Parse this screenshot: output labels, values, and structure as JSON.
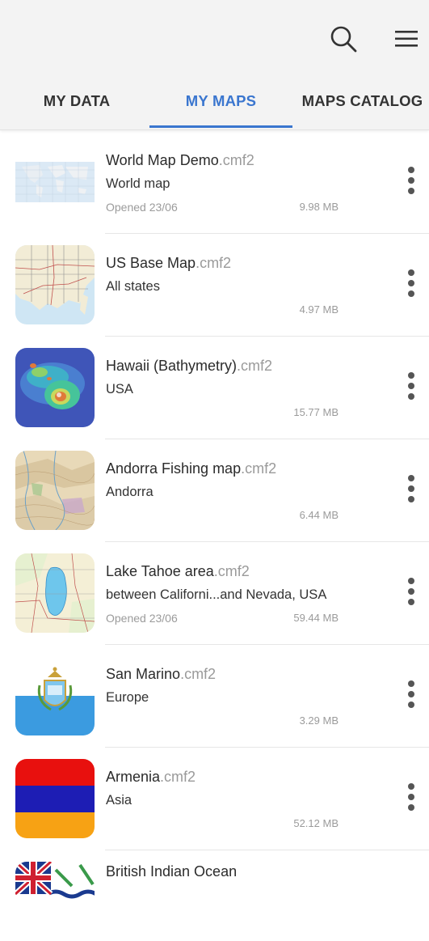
{
  "header": {
    "icons": {
      "search": "search-icon",
      "menu": "menu-icon"
    },
    "tabs": [
      {
        "label": "MY DATA"
      },
      {
        "label": "MY MAPS"
      },
      {
        "label": "MAPS CATALOG"
      }
    ],
    "active_tab": "MY MAPS",
    "accent_color": "#3a76cf"
  },
  "maps": [
    {
      "name": "World Map Demo",
      "ext": ".cmf2",
      "subtitle": "World map",
      "opened": "Opened 23/06",
      "size": "9.98 MB",
      "thumb": "world-map-thumbnail"
    },
    {
      "name": "US Base Map",
      "ext": ".cmf2",
      "subtitle": "All states",
      "opened": "",
      "size": "4.97 MB",
      "thumb": "us-base-map-thumbnail"
    },
    {
      "name": "Hawaii (Bathymetry)",
      "ext": ".cmf2",
      "subtitle": "USA",
      "opened": "",
      "size": "15.77 MB",
      "thumb": "hawaii-bathymetry-thumbnail"
    },
    {
      "name": "Andorra Fishing map",
      "ext": ".cmf2",
      "subtitle": "Andorra",
      "opened": "",
      "size": "6.44 MB",
      "thumb": "andorra-map-thumbnail"
    },
    {
      "name": "Lake Tahoe area",
      "ext": ".cmf2",
      "subtitle": "between Californi...and Nevada, USA",
      "opened": "Opened 23/06",
      "size": "59.44 MB",
      "thumb": "lake-tahoe-thumbnail"
    },
    {
      "name": "San Marino",
      "ext": ".cmf2",
      "subtitle": "Europe",
      "opened": "",
      "size": "3.29 MB",
      "thumb": "san-marino-flag"
    },
    {
      "name": "Armenia",
      "ext": ".cmf2",
      "subtitle": "Asia",
      "opened": "",
      "size": "52.12 MB",
      "thumb": "armenia-flag"
    },
    {
      "name": "British Indian Ocean",
      "ext": "",
      "subtitle": "",
      "opened": "",
      "size": "",
      "thumb": "british-indian-ocean-flag"
    }
  ]
}
